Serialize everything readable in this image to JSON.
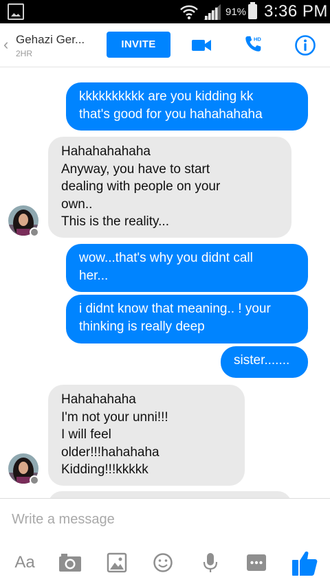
{
  "status_bar": {
    "battery_percent": "91%",
    "time": "3:36 PM"
  },
  "header": {
    "back_glyph": "‹",
    "contact_name": "Gehazi Ger...",
    "active_status": "2HR",
    "invite_label": "INVITE",
    "call_badge": "HD",
    "accent_color": "#0084ff"
  },
  "messages": [
    {
      "direction": "outgoing",
      "text": "kkkkkkkkkk are you kidding kk\nthat's good for you hahahahaha"
    },
    {
      "direction": "incoming",
      "text": "Hahahahahaha\nAnyway, you have to start\ndealing with people on your\nown..\nThis is the reality..."
    },
    {
      "direction": "outgoing",
      "text": "wow...that's why you didnt call\nher..."
    },
    {
      "direction": "outgoing",
      "text": "i didnt know that meaning.. ! your\nthinking is really deep"
    },
    {
      "direction": "outgoing",
      "text": "sister......."
    },
    {
      "direction": "incoming",
      "text": "Hahahahaha\nI'm not your unni!!!\nI will feel\nolder!!!hahahaha\nKidding!!!kkkkk"
    }
  ],
  "composer": {
    "placeholder": "Write a message",
    "text_format_label": "Aa",
    "tools": [
      "camera-icon",
      "gallery-icon",
      "emoji-icon",
      "microphone-icon",
      "more-icon",
      "like-icon"
    ]
  },
  "colors": {
    "outgoing_bubble": "#0084ff",
    "incoming_bubble": "#e9e9e9",
    "icon_gray": "#8f8f8f"
  }
}
